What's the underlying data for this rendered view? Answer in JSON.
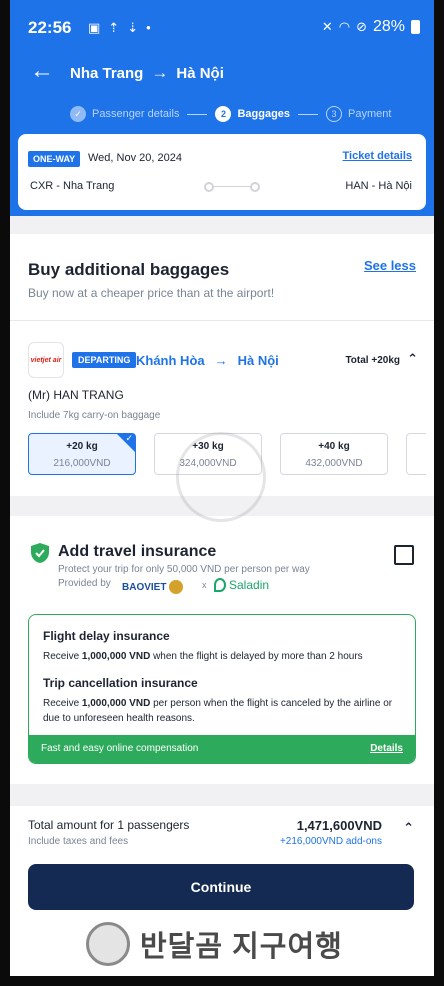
{
  "status": {
    "time": "22:56",
    "battery": "28%"
  },
  "nav": {
    "from": "Nha Trang",
    "arrow": "→",
    "to": "Hà Nội"
  },
  "steps": [
    {
      "label": "Passenger details",
      "num": "✓"
    },
    {
      "label": "Baggages",
      "num": "2"
    },
    {
      "label": "Payment",
      "num": "3"
    }
  ],
  "trip": {
    "badge": "ONE-WAY",
    "date": "Wed, Nov 20, 2024",
    "ticket_details": "Ticket details",
    "from": "CXR - Nha Trang",
    "to": "HAN - Hà Nội"
  },
  "baggage": {
    "title": "Buy additional baggages",
    "see_less": "See less",
    "subtitle": "Buy now at a cheaper price than at the airport!",
    "airline": "vietjet air",
    "departing": "DEPARTING",
    "route_from": "Khánh Hòa",
    "route_arrow": "→",
    "route_to": "Hà Nội",
    "total": "Total +20kg",
    "passenger": "(Mr) HAN TRANG",
    "carry_on": "Include 7kg carry-on baggage",
    "options": [
      {
        "kg": "+20 kg",
        "price": "216,000VND"
      },
      {
        "kg": "+30 kg",
        "price": "324,000VND"
      },
      {
        "kg": "+40 kg",
        "price": "432,000VND"
      }
    ]
  },
  "insurance": {
    "title": "Add travel insurance",
    "subtitle": "Protect your trip for only 50,000 VND per person per way",
    "provided_by": "Provided by",
    "provider1": "BAOVIET",
    "x": "x",
    "provider2": "Saladin",
    "delay_title": "Flight delay insurance",
    "delay_pre": "Receive ",
    "delay_amt": "1,000,000 VND",
    "delay_post": " when the flight is delayed by more than 2 hours",
    "cancel_title": "Trip cancellation insurance",
    "cancel_pre": "Receive ",
    "cancel_amt": "1,000,000 VND",
    "cancel_post": " per person when the flight is canceled by the airline or due to unforeseen health reasons.",
    "footer_left": "Fast and easy online compensation",
    "footer_right": "Details"
  },
  "footer": {
    "total_label": "Total amount for 1 passengers",
    "total_sub": "Include taxes and fees",
    "total_amount": "1,471,600VND",
    "addon": "+216,000VND add-ons",
    "continue": "Continue",
    "watermark": "반달곰 지구여행"
  },
  "colors": {
    "primary": "#1f73e8",
    "navy": "#152a52",
    "green": "#2eaa5c"
  }
}
